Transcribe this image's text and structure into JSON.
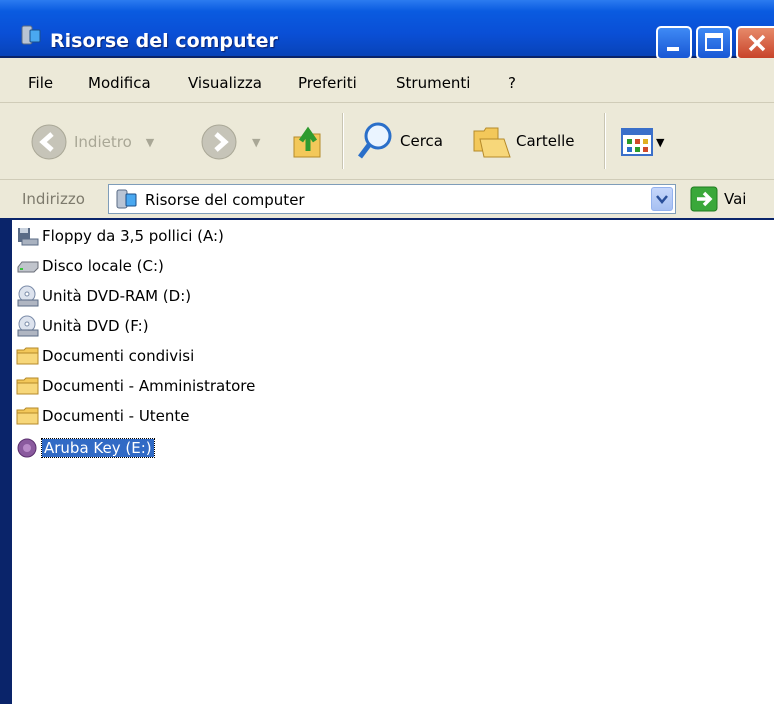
{
  "window": {
    "title": "Risorse del computer"
  },
  "menu": {
    "items": [
      "File",
      "Modifica",
      "Visualizza",
      "Preferiti",
      "Strumenti",
      "?"
    ]
  },
  "toolbar": {
    "back_label": "Indietro",
    "search_label": "Cerca",
    "folders_label": "Cartelle"
  },
  "address": {
    "label": "Indirizzo",
    "value": "Risorse del computer",
    "go_label": "Vai"
  },
  "items": [
    {
      "label": "Floppy da 3,5 pollici (A:)",
      "icon": "floppy-drive-icon"
    },
    {
      "label": "Disco locale (C:)",
      "icon": "hard-disk-icon"
    },
    {
      "label": "Unità DVD-RAM (D:)",
      "icon": "dvd-drive-icon"
    },
    {
      "label": "Unità DVD (F:)",
      "icon": "dvd-drive-icon"
    },
    {
      "label": "Documenti condivisi",
      "icon": "folder-icon"
    },
    {
      "label": "Documenti - Amministratore",
      "icon": "folder-icon"
    },
    {
      "label": "Documenti - Utente",
      "icon": "folder-icon"
    },
    {
      "label": "Aruba Key (E:)",
      "icon": "aruba-key-icon",
      "selected": true
    }
  ],
  "colors": {
    "titlebar": "#0a4fd6",
    "selection": "#316ac5",
    "chrome": "#ece9d8"
  }
}
